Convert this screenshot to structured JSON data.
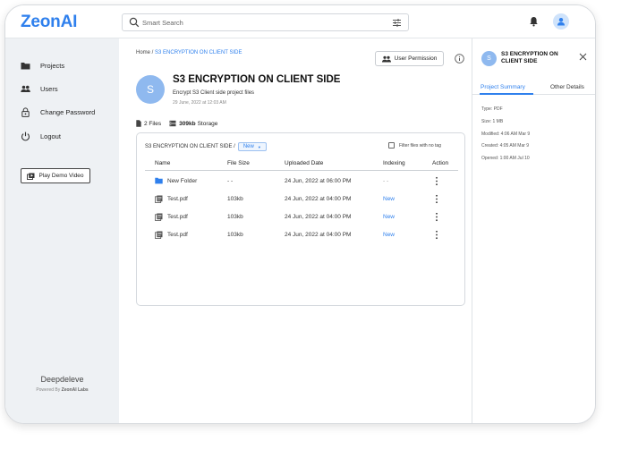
{
  "app": {
    "logo": "ZeonAI"
  },
  "search": {
    "placeholder": "Smart Search"
  },
  "sidebar": {
    "items": [
      {
        "label": "Projects",
        "icon": "folder-icon"
      },
      {
        "label": "Users",
        "icon": "users-icon"
      },
      {
        "label": "Change Password",
        "icon": "lock-icon"
      },
      {
        "label": "Logout",
        "icon": "power-icon"
      }
    ],
    "demo_button": "Play Demo Video",
    "brand": "Deepdeleve",
    "powered_prefix": "Powered By",
    "powered_brand": "ZeonAI Labs"
  },
  "breadcrumb": {
    "home": "Home",
    "sep": " / ",
    "current": "S3 ENCRYPTION ON CLIENT SIDE"
  },
  "header": {
    "user_permission": "User Permission"
  },
  "project": {
    "avatar_letter": "S",
    "title": "S3 ENCRYPTION ON CLIENT SIDE",
    "description": "Encrypt S3 Client side project files",
    "date": "29 June, 2022 at 12:03 AM"
  },
  "stats": {
    "files": "2 Files",
    "storage_value": "309kb",
    "storage_label": "Storage"
  },
  "files": {
    "path": "S3 ENCRYPTION ON CLIENT SIDE /",
    "tag_select": "New",
    "filter_label": "Filter files with no tag",
    "columns": [
      "Name",
      "File Size",
      "Uploaded Date",
      "Indexing",
      "Action"
    ],
    "rows": [
      {
        "type": "folder",
        "name": "New Folder",
        "size": "- -",
        "date": "24 Jun, 2022 at 06:00 PM",
        "indexing": "- -"
      },
      {
        "type": "file",
        "name": "Test.pdf",
        "size": "103kb",
        "date": "24 Jun, 2022 at 04:00 PM",
        "indexing": "New"
      },
      {
        "type": "file",
        "name": "Test.pdf",
        "size": "103kb",
        "date": "24 Jun, 2022 at 04:00 PM",
        "indexing": "New"
      },
      {
        "type": "file",
        "name": "Test.pdf",
        "size": "103kb",
        "date": "24 Jun, 2022 at 04:00 PM",
        "indexing": "New"
      }
    ]
  },
  "panel": {
    "avatar_letter": "S",
    "title": "S3 ENCRYPTION ON CLIENT SIDE",
    "tabs": [
      "Project Summary",
      "Other Details"
    ],
    "meta": [
      "Type: PDF",
      "Size: 1 MB",
      "Modified: 4:06 AM Mar 9",
      "Created: 4:05 AM Mar 9",
      "Opened: 1:00 AM Jul 10"
    ]
  },
  "colors": {
    "accent": "#2f80ed",
    "sidebar_bg": "#eef1f4",
    "avatar": "#8fb9ef"
  }
}
